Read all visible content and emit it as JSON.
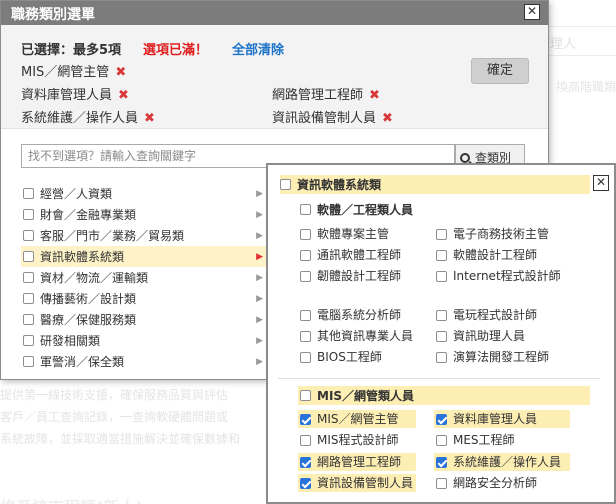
{
  "background": {
    "top_input": "管理人",
    "side_text": "換高階職類",
    "lines": [
      "提供第一線技術支援，確保服務品質與評估",
      "客戶／員工查詢記錄，一查詢軟硬體問題或",
      "系統故障，並採取適當措施解決並確保數據和",
      "修系統工程師(新人)"
    ]
  },
  "dialog": {
    "title": "職務類別選單",
    "close": "✕",
    "selected_label": "已選擇：最多5項",
    "full_notice": "選項已滿！",
    "clear_all": "全部清除",
    "confirm": "確定",
    "remove_icon": "✖",
    "chips": [
      "MIS／網管主管",
      "資料庫管理人員",
      "網路管理工程師",
      "系統維護／操作人員",
      "資訊設備管制人員"
    ],
    "search_placeholder": "找不到選項？請輸入查詢關鍵字",
    "search_button": "查類別",
    "categories": [
      {
        "label": "經營／人資類",
        "active": false
      },
      {
        "label": "財會／金融專業類",
        "active": false
      },
      {
        "label": "客服／門市／業務／貿易類",
        "active": false
      },
      {
        "label": "資訊軟體系統類",
        "active": true
      },
      {
        "label": "資材／物流／運輸類",
        "active": false
      },
      {
        "label": "傳播藝術／設計類",
        "active": false
      },
      {
        "label": "醫療／保健服務類",
        "active": false
      },
      {
        "label": "研發相關類",
        "active": false
      },
      {
        "label": "軍警消／保全類",
        "active": false
      }
    ],
    "arrow": "▶"
  },
  "subpanel": {
    "title": "資訊軟體系統類",
    "close": "✕",
    "group1": {
      "label": "軟體／工程類人員",
      "items": [
        {
          "label": "軟體專案主管",
          "checked": false
        },
        {
          "label": "電子商務技術主管",
          "checked": false
        },
        {
          "label": "通訊軟體工程師",
          "checked": false
        },
        {
          "label": "軟體設計工程師",
          "checked": false
        },
        {
          "label": "韌體設計工程師",
          "checked": false
        },
        {
          "label": "Internet程式設計師",
          "checked": false
        },
        {
          "label": "電腦系統分析師",
          "checked": false
        },
        {
          "label": "電玩程式設計師",
          "checked": false
        },
        {
          "label": "其他資訊專業人員",
          "checked": false
        },
        {
          "label": "資訊助理人員",
          "checked": false
        },
        {
          "label": "BIOS工程師",
          "checked": false
        },
        {
          "label": "演算法開發工程師",
          "checked": false
        }
      ]
    },
    "group2": {
      "label": "MIS／網管類人員",
      "items": [
        {
          "label": "MIS／網管主管",
          "checked": true
        },
        {
          "label": "資料庫管理人員",
          "checked": true
        },
        {
          "label": "MIS程式設計師",
          "checked": false
        },
        {
          "label": "MES工程師",
          "checked": false
        },
        {
          "label": "網路管理工程師",
          "checked": true
        },
        {
          "label": "系統維護／操作人員",
          "checked": true
        },
        {
          "label": "資訊設備管制人員",
          "checked": true
        },
        {
          "label": "網路安全分析師",
          "checked": false
        }
      ]
    }
  }
}
